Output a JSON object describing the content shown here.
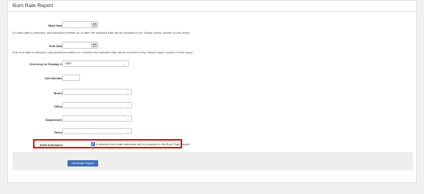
{
  "page": {
    "title": "Burn Rate Report"
  },
  "form": {
    "start_date": {
      "label": "Start Date",
      "help": "If a start date is selected, only timesheet entries on or after the selected date will be included in the 'Actual Hours' column of this report."
    },
    "end_date": {
      "label": "End Date",
      "help": "If an end date is selected, only timesheet entries on or before the selected date will be included in the 'Actual Hours' column of this report."
    },
    "currency": {
      "label": "Currency to Display in",
      "value": "GBP"
    },
    "job_number": {
      "label": "Job Number"
    },
    "brand": {
      "label": "Brand"
    },
    "office": {
      "label": "Office"
    },
    "department": {
      "label": "Department"
    },
    "roles": {
      "label": "Roles"
    },
    "draft_estimates": {
      "label": "Draft Estimates",
      "checked": true,
      "text": "If selected then draft estimates will be included in the Burn Rate Report"
    },
    "submit_label": "Generate Report"
  },
  "icons": {
    "calendar": "calendar-icon",
    "chevron": "chevron-down-icon",
    "check": "checkmark-icon"
  },
  "colors": {
    "primary_button": "#3f6fb5",
    "highlight_border": "#e0161e",
    "checkbox": "#3a7bd5"
  }
}
